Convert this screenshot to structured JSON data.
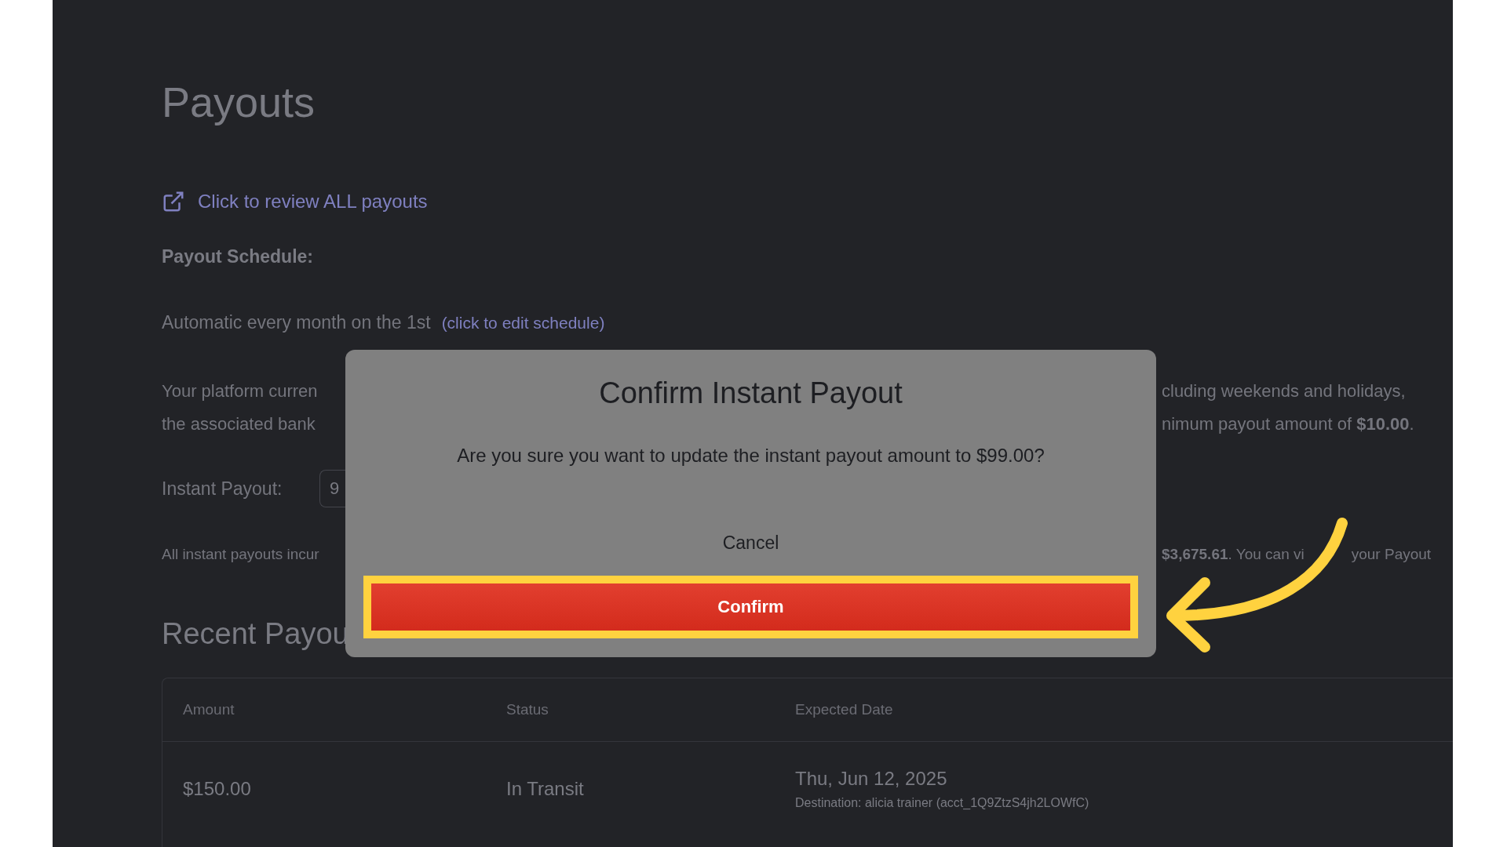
{
  "page": {
    "title": "Payouts",
    "review_link": "Click to review ALL payouts",
    "schedule_label": "Payout Schedule:",
    "schedule_text": "Automatic every month on the 1st",
    "edit_schedule_link": "(click to edit schedule)",
    "description_lines": [
      {
        "left": "Your platform curren",
        "right": "cluding weekends and holidays,"
      },
      {
        "left": "the associated bank",
        "right": "nimum payout amount of **$10.00**."
      }
    ],
    "instant_payout": {
      "label": "Instant Payout:",
      "value": "9"
    },
    "fee_note": {
      "left": "All instant payouts incur",
      "right": "**$3,675.61**. You can vi",
      "right_after": "your Payout"
    },
    "recent_heading": "Recent Payou",
    "table": {
      "columns": [
        "Amount",
        "Status",
        "Expected Date"
      ],
      "rows": [
        {
          "amount": "$150.00",
          "status": "In Transit",
          "date": "Thu, Jun 12, 2025",
          "destination": "Destination: alicia trainer (acct_1Q9ZtzS4jh2LOWfC)"
        }
      ]
    }
  },
  "dialog": {
    "title": "Confirm Instant Payout",
    "message": "Are you sure you want to update the instant payout amount to $99.00?",
    "buttons": [
      {
        "label": "Cancel",
        "kind": "text",
        "highlighted": false
      },
      {
        "label": "Confirm",
        "kind": "primary",
        "highlighted": true
      }
    ]
  }
}
